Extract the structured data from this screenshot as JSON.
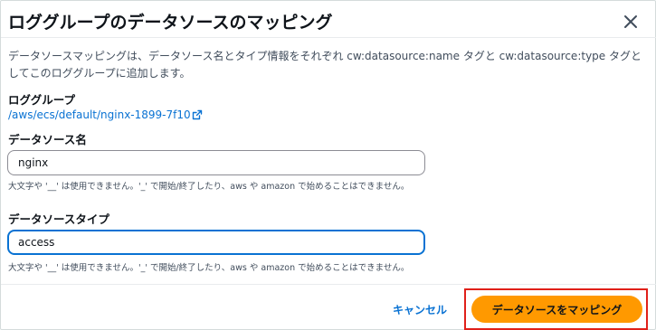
{
  "dialog": {
    "title": "ロググループのデータソースのマッピング",
    "description": "データソースマッピングは、データソース名とタイプ情報をそれぞれ cw:datasource:name タグと cw:datasource:type タグとしてこのロググループに追加します。"
  },
  "log_group": {
    "label": "ロググループ",
    "link_text": "/aws/ecs/default/nginx-1899-7f10"
  },
  "datasource_name": {
    "label": "データソース名",
    "value": "nginx",
    "hint": "大文字や '__' は使用できません。'_' で開始/終了したり、aws や amazon で始めることはできません。"
  },
  "datasource_type": {
    "label": "データソースタイプ",
    "value": "access",
    "hint": "大文字や '__' は使用できません。'_' で開始/終了したり、aws や amazon で始めることはできません。"
  },
  "footer": {
    "cancel_label": "キャンセル",
    "submit_label": "データソースをマッピング"
  },
  "colors": {
    "primary_button": "#ff9900",
    "link": "#0972d3",
    "focus_border": "#0972d3",
    "highlight_box": "#e0201a"
  },
  "icons": {
    "close": "close-icon",
    "external_link": "external-link-icon"
  }
}
